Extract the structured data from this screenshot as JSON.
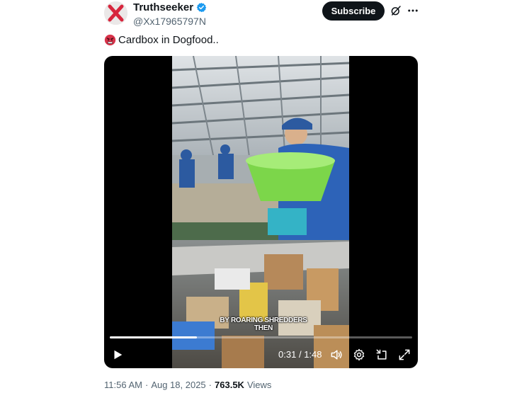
{
  "author": {
    "display_name": "Truthseeker",
    "handle": "@Xx17965797N",
    "avatar": "red-x-avatar",
    "verified": true
  },
  "header": {
    "subscribe_label": "Subscribe",
    "grok_icon": "grok-icon",
    "more_icon": "more-icon"
  },
  "post": {
    "emoji": "angry-face-emoji",
    "text": "Cardbox in Dogfood.."
  },
  "video": {
    "caption": "BY ROARING SHREDDERS THEN",
    "current_time": "0:31",
    "separator": "/",
    "duration": "1:48",
    "progress": 0.287,
    "controls": [
      "play-icon",
      "volume-icon",
      "settings-icon",
      "exit-fullscreen-icon",
      "fullscreen-icon"
    ]
  },
  "footer": {
    "time": "11:56 AM",
    "dot1": "·",
    "date": "Aug 18, 2025",
    "dot2": "·",
    "views": "763.5K",
    "views_label": "Views"
  },
  "colors": {
    "text": "#0f1419",
    "secondary": "#536471",
    "verified_blue": "#1d9bf0",
    "avatar_x": "#e0245e"
  }
}
